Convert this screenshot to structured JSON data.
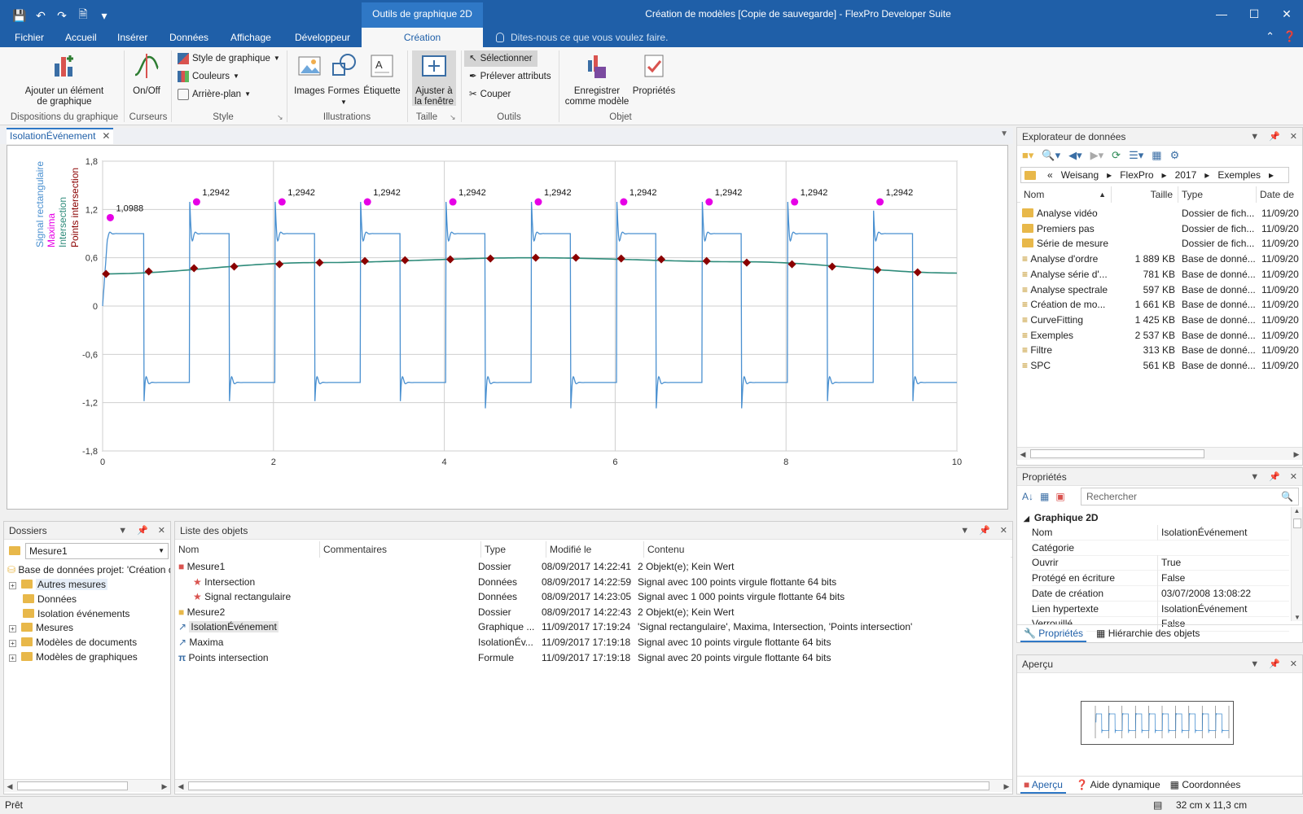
{
  "window": {
    "title": "Création de modèles [Copie de sauvegarde] - FlexPro Developer Suite",
    "contextual_tab_group": "Outils de graphique 2D"
  },
  "ribbon_tabs": [
    "Fichier",
    "Accueil",
    "Insérer",
    "Données",
    "Affichage",
    "Développeur",
    "Création"
  ],
  "tell_me": "Dites-nous ce que vous voulez faire.",
  "ribbon": {
    "add_element": "Ajouter un élément de graphique",
    "onoff": "On/Off",
    "style_graph": "Style de graphique",
    "colors": "Couleurs",
    "background": "Arrière-plan",
    "images": "Images",
    "shapes": "Formes",
    "label": "Étiquette",
    "fit_window": "Ajuster à la fenêtre",
    "select": "Sélectionner",
    "pick_attr": "Prélever attributs",
    "cut": "Couper",
    "save_template": "Enregistrer comme modèle",
    "properties": "Propriétés",
    "groups": {
      "layouts": "Dispositions du graphique",
      "cursors": "Curseurs",
      "style": "Style",
      "illustrations": "Illustrations",
      "size": "Taille",
      "tools": "Outils",
      "object": "Objet"
    }
  },
  "document_tab": "IsolationÉvénement",
  "chart_data": {
    "type": "line",
    "xlim": [
      0,
      10
    ],
    "ylim": [
      -1.8,
      1.8
    ],
    "xticks": [
      "0",
      "2",
      "4",
      "6",
      "8",
      "10"
    ],
    "yticks": [
      "1,8",
      "1,2",
      "0,6",
      "0",
      "-0,6",
      "-1,2",
      "-1,8"
    ],
    "grid": true,
    "legend_position": "left-vertical",
    "series": [
      {
        "name": "Signal rectangulaire",
        "color": "#4a90d0",
        "period": 1,
        "high": 0.9,
        "low": -0.95,
        "overshoot_peak": 1.2942,
        "undershoot_peak": -1.27
      },
      {
        "name": "Maxima",
        "color": "#e600e6",
        "x": [
          0.09,
          1.1,
          2.1,
          3.1,
          4.1,
          5.1,
          6.1,
          7.1,
          8.1,
          9.1
        ],
        "y": [
          1.0988,
          1.2942,
          1.2942,
          1.2942,
          1.2942,
          1.2942,
          1.2942,
          1.2942,
          1.2942,
          1.2942
        ]
      },
      {
        "name": "Intersection",
        "color": "#2e8b7a",
        "x": [
          0,
          2.5,
          5,
          7.5,
          10
        ],
        "y": [
          0.4,
          0.54,
          0.6,
          0.55,
          0.41
        ]
      },
      {
        "name": "Points intersection",
        "color": "#8b0000",
        "x": [
          0.04,
          0.54,
          1.07,
          1.54,
          2.07,
          2.54,
          3.07,
          3.54,
          4.07,
          4.54,
          5.07,
          5.54,
          6.07,
          6.54,
          7.07,
          7.54,
          8.07,
          8.54,
          9.07,
          9.54
        ],
        "y": [
          0.4,
          0.43,
          0.47,
          0.49,
          0.52,
          0.54,
          0.56,
          0.57,
          0.58,
          0.59,
          0.6,
          0.6,
          0.59,
          0.58,
          0.56,
          0.54,
          0.52,
          0.49,
          0.45,
          0.42
        ]
      }
    ],
    "maxima_labels": [
      "1,0988",
      "1,2942",
      "1,2942",
      "1,2942",
      "1,2942",
      "1,2942",
      "1,2942",
      "1,2942",
      "1,2942",
      "1,2942"
    ]
  },
  "data_explorer": {
    "title": "Explorateur de données",
    "breadcrumb": [
      "«",
      "Weisang",
      "FlexPro",
      "2017",
      "Exemples"
    ],
    "columns": [
      "Nom",
      "Taille",
      "Type",
      "Date de"
    ],
    "rows": [
      {
        "name": "Analyse vidéo",
        "size": "",
        "type": "Dossier de fich...",
        "date": "11/09/20",
        "kind": "folder"
      },
      {
        "name": "Premiers pas",
        "size": "",
        "type": "Dossier de fich...",
        "date": "11/09/20",
        "kind": "folder"
      },
      {
        "name": "Série de mesure",
        "size": "",
        "type": "Dossier de fich...",
        "date": "11/09/20",
        "kind": "folder"
      },
      {
        "name": "Analyse d'ordre",
        "size": "1 889 KB",
        "type": "Base de donné...",
        "date": "11/09/20",
        "kind": "db"
      },
      {
        "name": "Analyse série d'...",
        "size": "781 KB",
        "type": "Base de donné...",
        "date": "11/09/20",
        "kind": "db"
      },
      {
        "name": "Analyse spectrale",
        "size": "597 KB",
        "type": "Base de donné...",
        "date": "11/09/20",
        "kind": "db"
      },
      {
        "name": "Création de mo...",
        "size": "1 661 KB",
        "type": "Base de donné...",
        "date": "11/09/20",
        "kind": "db"
      },
      {
        "name": "CurveFitting",
        "size": "1 425 KB",
        "type": "Base de donné...",
        "date": "11/09/20",
        "kind": "db"
      },
      {
        "name": "Exemples",
        "size": "2 537 KB",
        "type": "Base de donné...",
        "date": "11/09/20",
        "kind": "db"
      },
      {
        "name": "Filtre",
        "size": "313 KB",
        "type": "Base de donné...",
        "date": "11/09/20",
        "kind": "db"
      },
      {
        "name": "SPC",
        "size": "561 KB",
        "type": "Base de donné...",
        "date": "11/09/20",
        "kind": "db"
      }
    ]
  },
  "properties": {
    "title": "Propriétés",
    "search_placeholder": "Rechercher",
    "section": "Graphique 2D",
    "rows": [
      {
        "k": "Nom",
        "v": "IsolationÉvénement"
      },
      {
        "k": "Catégorie",
        "v": ""
      },
      {
        "k": "Ouvrir",
        "v": "True"
      },
      {
        "k": "Protégé en écriture",
        "v": "False"
      },
      {
        "k": "Date de création",
        "v": "03/07/2008 13:08:22"
      },
      {
        "k": "Lien hypertexte",
        "v": "IsolationÉvénement"
      },
      {
        "k": "Verrouillé",
        "v": "False"
      }
    ],
    "tabs": [
      "Propriétés",
      "Hiérarchie des objets"
    ]
  },
  "preview": {
    "title": "Aperçu",
    "tabs": [
      "Aperçu",
      "Aide dynamique",
      "Coordonnées"
    ]
  },
  "folders": {
    "title": "Dossiers",
    "combo": "Mesure1",
    "root": "Base de données projet: 'Création d",
    "items": [
      {
        "label": "Autres mesures",
        "expander": true,
        "selected": true
      },
      {
        "label": "Données",
        "expander": false
      },
      {
        "label": "Isolation événements",
        "expander": false
      },
      {
        "label": "Mesures",
        "expander": true
      },
      {
        "label": "Modèles de documents",
        "expander": true
      },
      {
        "label": "Modèles de graphiques",
        "expander": true
      }
    ]
  },
  "object_list": {
    "title": "Liste des objets",
    "columns": [
      "Nom",
      "Commentaires",
      "Type",
      "Modifié le",
      "Contenu"
    ],
    "rows": [
      {
        "name": "Mesure1",
        "type": "Dossier",
        "modified": "08/09/2017 14:22:41",
        "content": "2 Objekt(e); Kein Wert",
        "indent": 0,
        "icon": "red-folder"
      },
      {
        "name": "Intersection",
        "type": "Données",
        "modified": "08/09/2017 14:22:59",
        "content": "Signal avec 100 points virgule flottante 64 bits",
        "indent": 1,
        "icon": "signal"
      },
      {
        "name": "Signal rectangulaire",
        "type": "Données",
        "modified": "08/09/2017 14:23:05",
        "content": "Signal avec 1 000 points virgule flottante 64 bits",
        "indent": 1,
        "icon": "signal"
      },
      {
        "name": "Mesure2",
        "type": "Dossier",
        "modified": "08/09/2017 14:22:43",
        "content": "2 Objekt(e); Kein Wert",
        "indent": 0,
        "icon": "folder"
      },
      {
        "name": "IsolationÉvénement",
        "type": "Graphique ...",
        "modified": "11/09/2017 17:19:24",
        "content": "'Signal rectangulaire', Maxima, Intersection, 'Points intersection'",
        "indent": 0,
        "icon": "graph"
      },
      {
        "name": "Maxima",
        "type": "IsolationÉv...",
        "modified": "11/09/2017 17:19:18",
        "content": "Signal avec 10 points virgule flottante 64 bits",
        "indent": 0,
        "icon": "graph"
      },
      {
        "name": "Points intersection",
        "type": "Formule",
        "modified": "11/09/2017 17:19:18",
        "content": "Signal avec 20 points virgule flottante 64 bits",
        "indent": 0,
        "icon": "pi"
      }
    ]
  },
  "status": {
    "left": "Prêt",
    "right": "32 cm x 11,3 cm"
  }
}
